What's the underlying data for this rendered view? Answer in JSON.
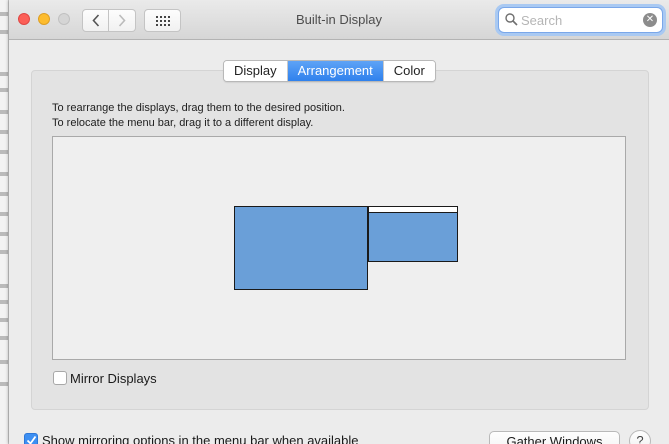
{
  "window": {
    "title": "Built-in Display"
  },
  "toolbar": {
    "back_icon": "chevron-left-icon",
    "forward_icon": "chevron-right-icon",
    "show_all_icon": "grid-icon"
  },
  "search": {
    "placeholder": "Search",
    "value": ""
  },
  "tabs": [
    {
      "label": "Display",
      "active": false
    },
    {
      "label": "Arrangement",
      "active": true
    },
    {
      "label": "Color",
      "active": false
    }
  ],
  "instructions": {
    "line1": "To rearrange the displays, drag them to the desired position.",
    "line2": "To relocate the menu bar, drag it to a different display."
  },
  "arrangement": {
    "display_color": "#6a9fd8",
    "displays": [
      {
        "role": "main"
      },
      {
        "role": "secondary",
        "has_menu_bar": true
      }
    ]
  },
  "options": {
    "mirror_displays": {
      "label": "Mirror Displays",
      "checked": false
    },
    "show_mirroring": {
      "label": "Show mirroring options in the menu bar when available",
      "checked": true
    }
  },
  "buttons": {
    "gather_windows": "Gather Windows",
    "help": "?"
  },
  "colors": {
    "accent": "#3d8ff2",
    "close": "#fc5f57",
    "minimize": "#fdbc2e",
    "zoom_disabled": "#d5d5d5"
  }
}
